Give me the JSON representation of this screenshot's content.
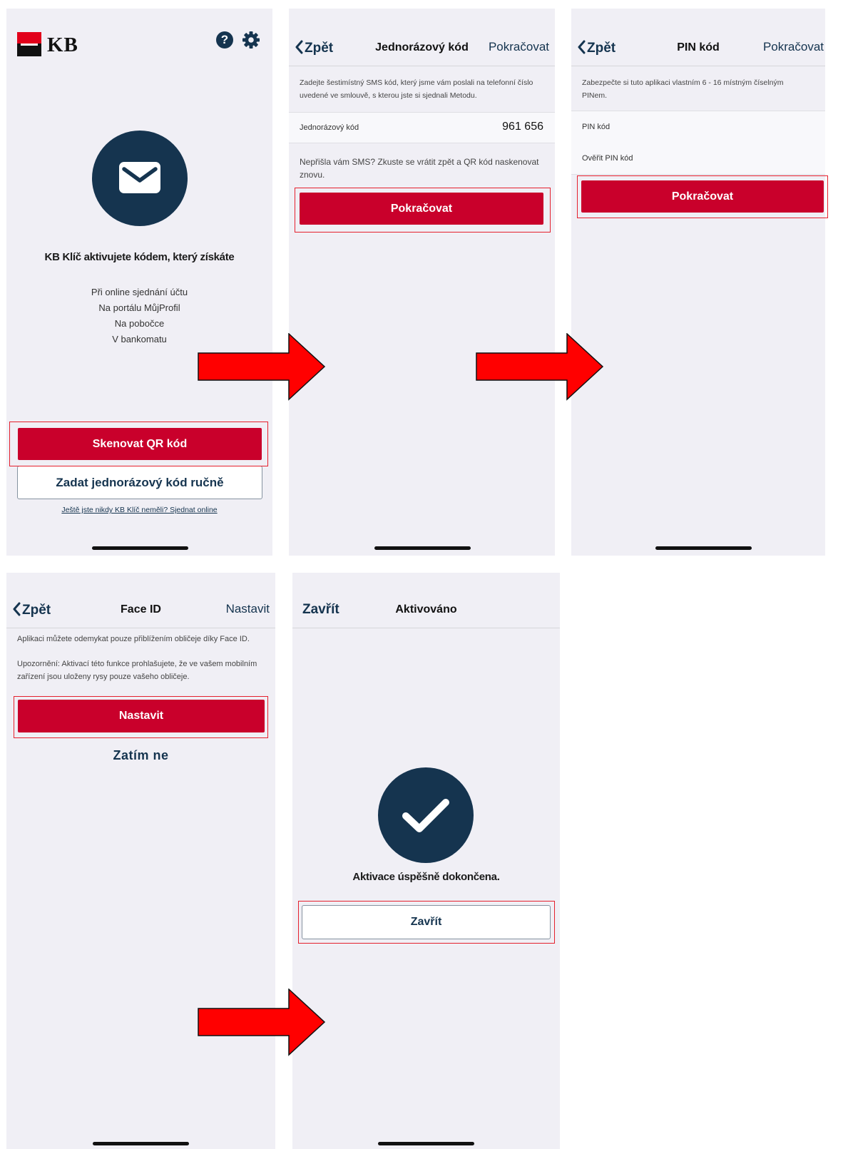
{
  "screen1": {
    "logo_text": "KB",
    "icons": [
      "help-icon",
      "gear-icon",
      "envelope-icon"
    ],
    "heading": "KB Klíč aktivujete kódem, který získáte",
    "options": [
      "Při online sjednání účtu",
      "Na portálu MůjProfil",
      "Na pobočce",
      "V bankomatu"
    ],
    "scan_button": "Skenovat QR kód",
    "manual_button": "Zadat jednorázový kód ručně",
    "link": "Ještě jste nikdy KB Klíč neměli? Sjednat online"
  },
  "screen2": {
    "back": "Zpět",
    "title": "Jednorázový kód",
    "right": "Pokračovat",
    "description": "Zadejte šestimístný SMS kód, který jsme vám poslali na telefonní číslo uvedené ve smlouvě, s kterou jste si sjednali Metodu.",
    "field_label": "Jednorázový kód",
    "field_value": "961 656",
    "note": "Nepřišla vám SMS? Zkuste se vrátit zpět a QR kód naskenovat znovu.",
    "button": "Pokračovat"
  },
  "screen3": {
    "back": "Zpět",
    "title": "PIN kód",
    "right": "Pokračovat",
    "description": "Zabezpečte si tuto aplikaci vlastním 6 - 16 místným číselným PINem.",
    "field1": "PIN kód",
    "field2": "Ověřit PIN kód",
    "button": "Pokračovat"
  },
  "screen4": {
    "back": "Zpět",
    "title": "Face ID",
    "right": "Nastavit",
    "description": "Aplikaci můžete odemykat pouze přiblížením obličeje díky Face ID.",
    "warning": "Upozornění: Aktivací této funkce prohlašujete, že ve vašem mobilním zařízení jsou uloženy rysy pouze vašeho obličeje.",
    "button": "Nastavit",
    "secondary": "Zatím ne"
  },
  "screen5": {
    "left": "Zavřít",
    "title": "Aktivováno",
    "message": "Aktivace úspěšně dokončena.",
    "button": "Zavřít",
    "icon": "checkmark-icon"
  },
  "colors": {
    "brand_red": "#c9002b",
    "navy": "#15344f",
    "arrow_red": "#ff0000",
    "highlight": "#e5202d"
  }
}
